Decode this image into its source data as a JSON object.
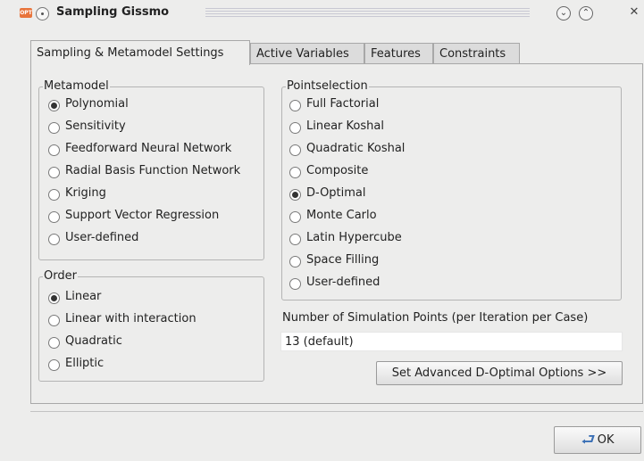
{
  "window": {
    "title": "Sampling Gissmo",
    "app_icon_text": "OPT",
    "controls": [
      {
        "name": "minimize",
        "glyph": "⌄"
      },
      {
        "name": "maximize",
        "glyph": "⌃"
      },
      {
        "name": "close",
        "glyph": "✕"
      }
    ]
  },
  "tabs": [
    {
      "label": "Sampling & Metamodel Settings",
      "active": true
    },
    {
      "label": "Active Variables",
      "active": false
    },
    {
      "label": "Features",
      "active": false
    },
    {
      "label": "Constraints",
      "active": false
    }
  ],
  "metamodel": {
    "title": "Metamodel",
    "options": [
      {
        "label": "Polynomial",
        "checked": true
      },
      {
        "label": "Sensitivity",
        "checked": false
      },
      {
        "label": "Feedforward Neural Network",
        "checked": false
      },
      {
        "label": "Radial Basis Function Network",
        "checked": false
      },
      {
        "label": "Kriging",
        "checked": false
      },
      {
        "label": "Support Vector Regression",
        "checked": false
      },
      {
        "label": "User-defined",
        "checked": false
      }
    ]
  },
  "order": {
    "title": "Order",
    "options": [
      {
        "label": "Linear",
        "checked": true
      },
      {
        "label": "Linear with interaction",
        "checked": false
      },
      {
        "label": "Quadratic",
        "checked": false
      },
      {
        "label": "Elliptic",
        "checked": false
      }
    ]
  },
  "pointselection": {
    "title": "Pointselection",
    "options": [
      {
        "label": "Full Factorial",
        "checked": false
      },
      {
        "label": "Linear Koshal",
        "checked": false
      },
      {
        "label": "Quadratic Koshal",
        "checked": false
      },
      {
        "label": "Composite",
        "checked": false
      },
      {
        "label": "D-Optimal",
        "checked": true
      },
      {
        "label": "Monte Carlo",
        "checked": false
      },
      {
        "label": "Latin Hypercube",
        "checked": false
      },
      {
        "label": "Space Filling",
        "checked": false
      },
      {
        "label": "User-defined",
        "checked": false
      }
    ]
  },
  "simulation_points": {
    "label": "Number of Simulation Points (per Iteration per Case)",
    "value": "13 (default)"
  },
  "advanced_button_label": "Set Advanced D-Optimal Options >>",
  "ok_button_label": "OK"
}
